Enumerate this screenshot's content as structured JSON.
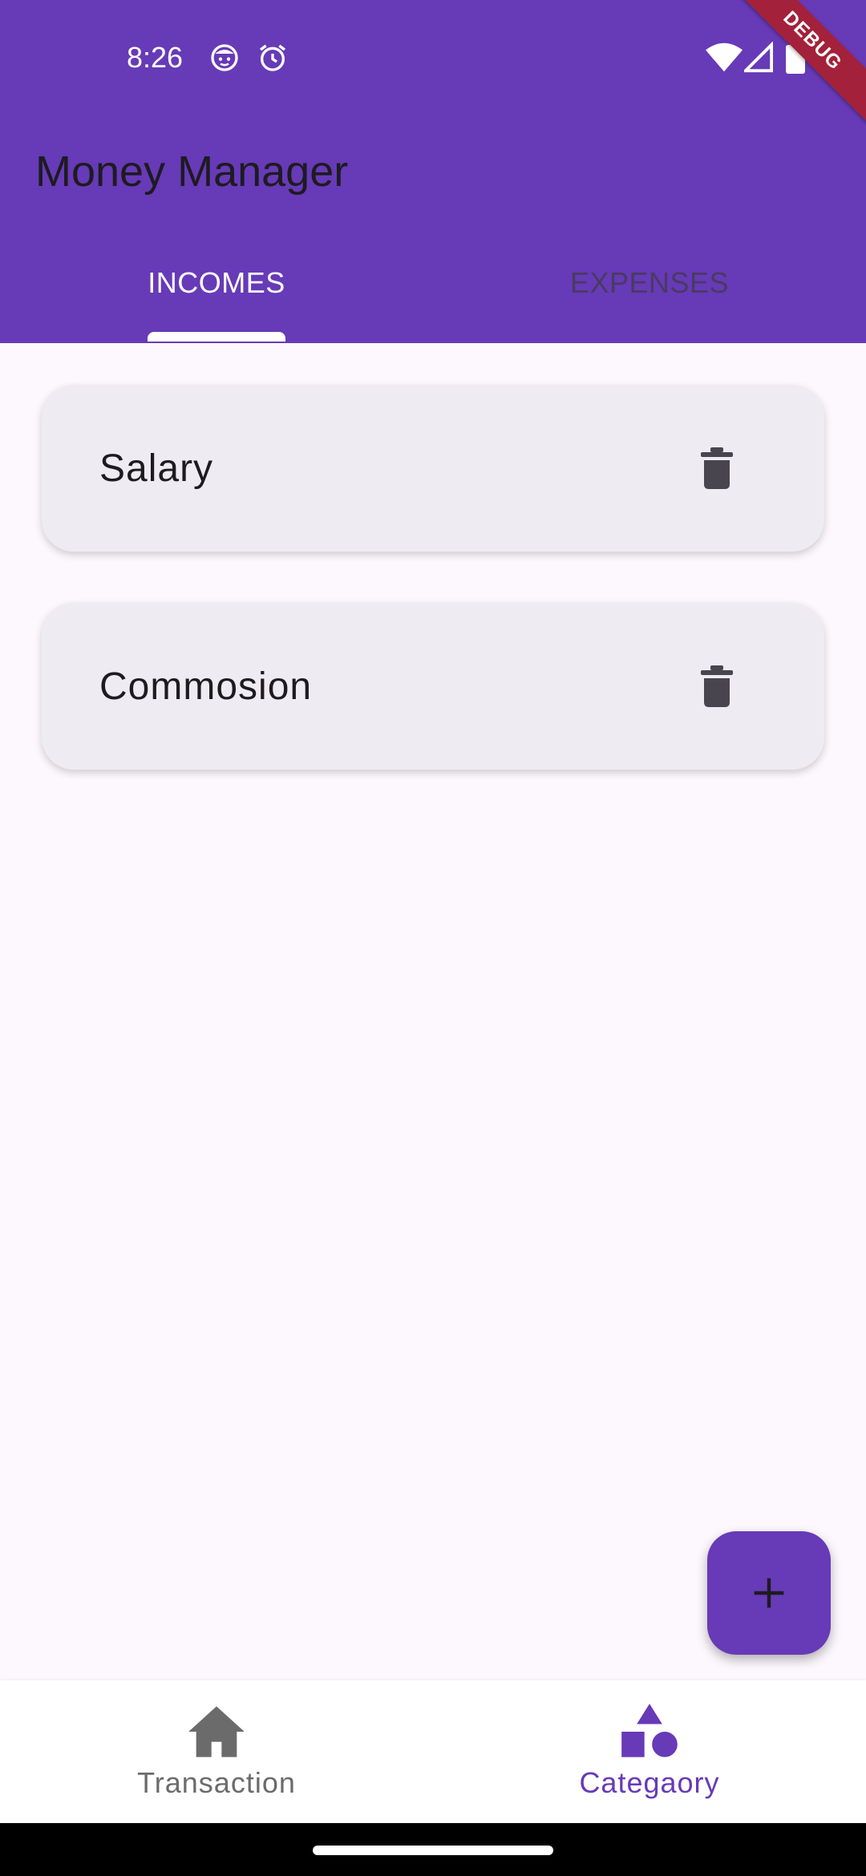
{
  "status_bar": {
    "time": "8:26",
    "left_icons": [
      "face-notification-icon",
      "alarm-icon"
    ],
    "right_icons": [
      "wifi-icon",
      "signal-icon",
      "battery-icon"
    ]
  },
  "debug_banner": "DEBUG",
  "app_bar": {
    "title": "Money Manager",
    "background_color": "#673ab7"
  },
  "tabs": [
    {
      "label": "INCOMES",
      "selected": true
    },
    {
      "label": "EXPENSES",
      "selected": false
    }
  ],
  "categories": [
    {
      "name": "Salary",
      "action_icon": "delete-icon"
    },
    {
      "name": "Commosion",
      "action_icon": "delete-icon"
    }
  ],
  "fab": {
    "icon": "plus-icon"
  },
  "bottom_nav": {
    "items": [
      {
        "label": "Transaction",
        "icon": "home-icon",
        "selected": false
      },
      {
        "label": "Categaory",
        "icon": "category-shapes-icon",
        "selected": true
      }
    ]
  }
}
